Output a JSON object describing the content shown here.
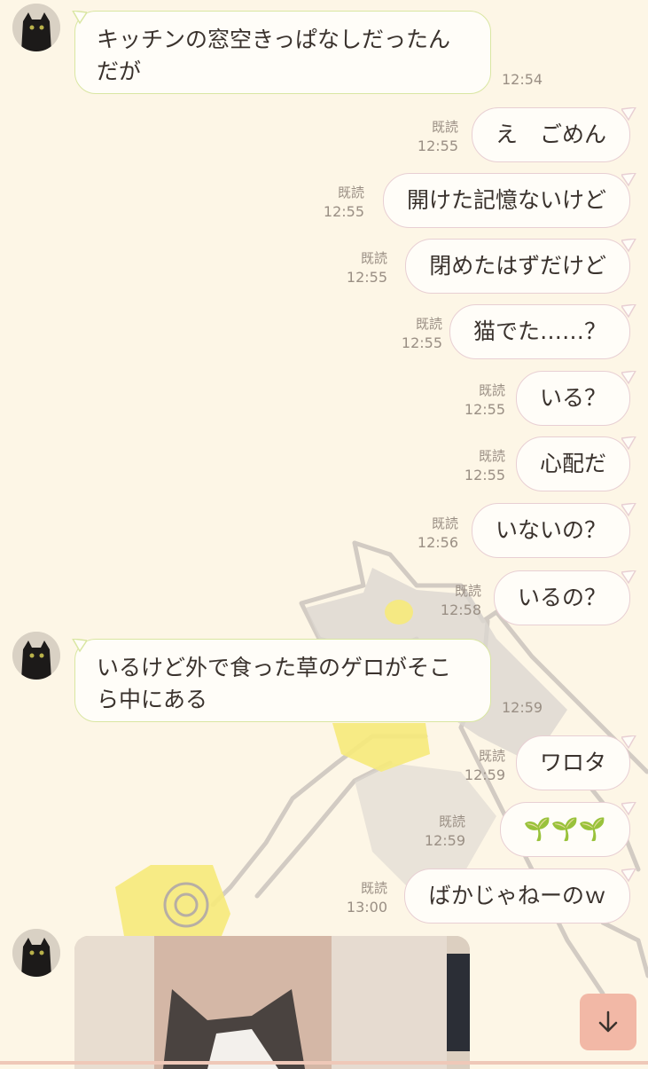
{
  "chat": {
    "read_label": "既読",
    "messages": [
      {
        "side": "in",
        "text_line1": "キッチンの窓空きっぱなしだったん",
        "text_line2": "だが",
        "time": "12:54"
      },
      {
        "side": "out",
        "text": "え　ごめん",
        "time": "12:55"
      },
      {
        "side": "out",
        "text": "開けた記憶ないけど",
        "time": "12:55"
      },
      {
        "side": "out",
        "text": "閉めたはずだけど",
        "time": "12:55"
      },
      {
        "side": "out",
        "text": "猫でた……？",
        "time": "12:55"
      },
      {
        "side": "out",
        "text": "いる？",
        "time": "12:55"
      },
      {
        "side": "out",
        "text": "心配だ",
        "time": "12:55"
      },
      {
        "side": "out",
        "text": "いないの？",
        "time": "12:56"
      },
      {
        "side": "out",
        "text": "いるの？",
        "time": "12:58"
      },
      {
        "side": "in",
        "text_line1": "いるけど外で食った草のゲロがそこ",
        "text_line2": "ら中にある",
        "time": "12:59"
      },
      {
        "side": "out",
        "text": "ワロタ",
        "time": "12:59"
      },
      {
        "side": "out",
        "text": "🌱🌱🌱",
        "time": "12:59"
      },
      {
        "side": "out",
        "text": "ばかじゃねーのｗ",
        "time": "13:00"
      }
    ]
  },
  "icons": {
    "avatar": "black-cat-avatar-icon",
    "scroll": "arrow-down-icon",
    "photo": "cat-photo"
  },
  "colors": {
    "background": "#fdf6e6",
    "incoming_border": "#d9e6a2",
    "outgoing_border": "#e8cfd3",
    "meta": "#9a8f84",
    "scroll_button": "#f2b8a6"
  }
}
